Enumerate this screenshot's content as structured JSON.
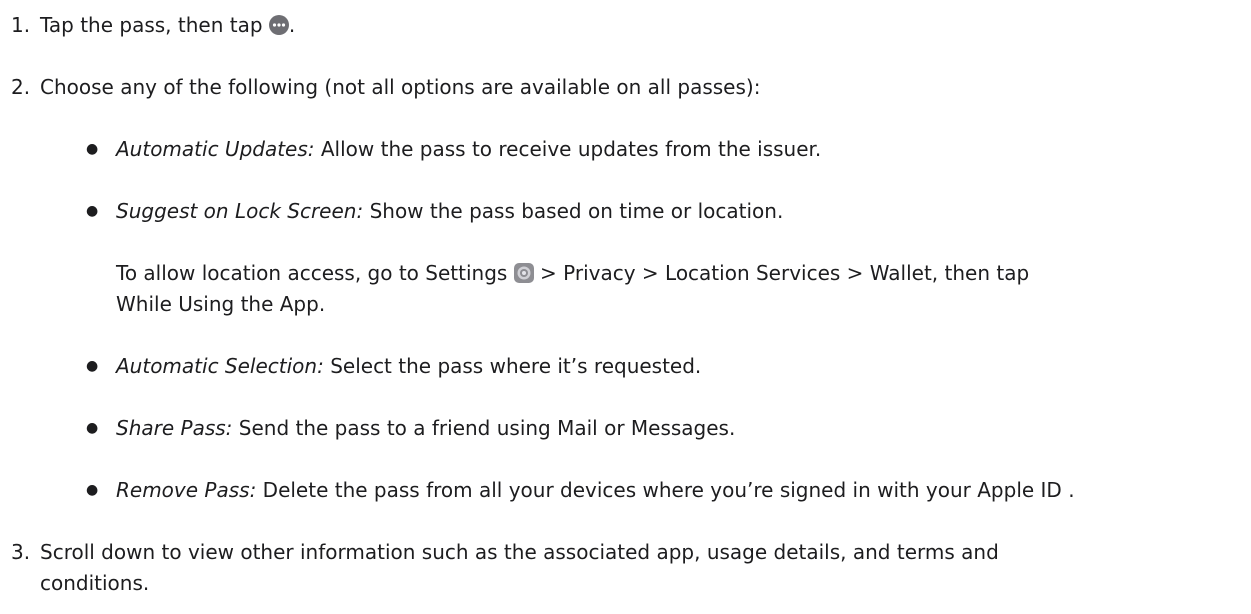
{
  "steps": [
    {
      "number": "1.",
      "before_icon": "Tap the pass, then tap",
      "icon": "more-icon",
      "after_icon": "."
    },
    {
      "number": "2.",
      "text": "Choose any of the following (not all options are available on all passes):",
      "options": [
        {
          "term": "Automatic Updates:",
          "text": "Allow the pass to receive updates from the issuer."
        },
        {
          "term": "Suggest on Lock Screen:",
          "text": "Show the pass based on time or location.",
          "note": {
            "before_icon": "To allow location access, go to Settings",
            "icon": "settings-icon",
            "after_icon_line1": "> Privacy > Location Services > Wallet, then tap",
            "line2": "While Using the App."
          }
        },
        {
          "term": "Automatic Selection:",
          "text": "Select the pass where it’s requested."
        },
        {
          "term": "Share Pass:",
          "text": "Send the pass to a friend using Mail or Messages."
        },
        {
          "term": "Remove Pass:",
          "text": "Delete the pass from all your devices where you’re signed in with your Apple ID ."
        }
      ]
    },
    {
      "number": "3.",
      "line1": "Scroll down to view other information such as the associated app, usage details, and terms and",
      "line2": "conditions."
    }
  ],
  "colors": {
    "text": "#1d1d1f",
    "more_icon_fill": "#6e6e73",
    "settings_icon_fill": "#8e8e93"
  }
}
